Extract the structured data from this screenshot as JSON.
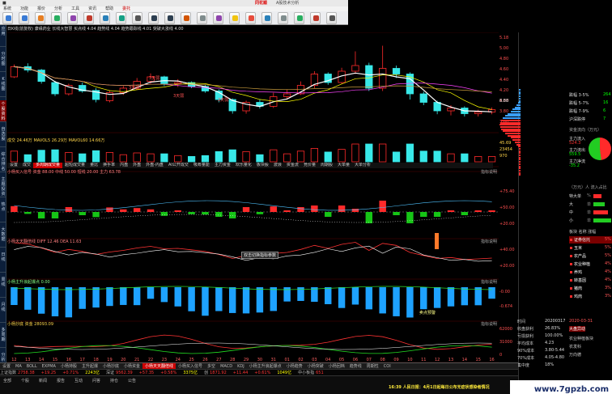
{
  "window": {
    "brand": "同花顺",
    "title": "A股技术分析",
    "menu": [
      "系统",
      "功能",
      "报价",
      "分析",
      "工具",
      "资讯",
      "帮助"
    ],
    "menu_accent": "委托",
    "toolbar_icons": [
      "back-icon",
      "forward-icon",
      "home-icon",
      "refresh-icon",
      "grid-icon",
      "chart-icon",
      "kline-icon",
      "list-icon",
      "search-icon",
      "zoom-in-icon",
      "zoom-out-icon",
      "news-icon",
      "f10-icon",
      "calc-icon",
      "star-icon",
      "alert-icon",
      "table-icon",
      "settings-icon",
      "draw-icon",
      "pen-icon",
      "print-icon"
    ]
  },
  "left_tabs": [
    "应用",
    "分时图",
    "K线图",
    "个股资料",
    "自选股",
    "综合排名",
    "主题投资",
    "热点",
    "大数据",
    "日线",
    "周线",
    "月线",
    "多周期",
    "分析"
  ],
  "main_chart": {
    "header": "日K线(前复权) 康缘药业 长线大智慧 买点线 4.04 趋势线 4.04 趋势跟踪线 4.01 突破大涨线 4.00",
    "price_labels": [
      "5.18",
      "5.00",
      "4.80",
      "4.60",
      "4.40",
      "4.20",
      "4.00",
      "3.80",
      "3.60"
    ],
    "annotations": [
      "3天弱",
      "3天弱",
      "2天弱",
      "3天弱"
    ],
    "right_label": "8.88"
  },
  "volume_panel": {
    "header": "成交 24.46万 MAVOL5 26.29万 MAVOL60 14.66万",
    "right_labels": [
      "45.69",
      "23454",
      "970"
    ],
    "tabs": [
      "设置",
      "成交",
      "多周期成交量",
      "超短成交量",
      "量比",
      "换手率",
      "内盘",
      "外盘",
      "外盘-内盘",
      "AI公开成交",
      "吸筹量能",
      "主力资金",
      "欢乐量化",
      "板块股",
      "波浪",
      "资金流",
      "竞价量",
      "周期股",
      "大单量",
      "大单分析"
    ]
  },
  "indicator1": {
    "header": "小杨买入信号 资金 88.00 中线 50.00 短线 20.00 主力 63.78",
    "right_label": "指标说明",
    "scale": [
      "+75.40",
      "+50.00",
      "+20.00"
    ]
  },
  "indicator2": {
    "header": "小杨天天翻倍线 DIFF 12.46 DEA 11.63",
    "right_label": "指标说明",
    "tooltip": "双击切换指标参数",
    "marker": "卖点预警",
    "scale": [
      "+40.00",
      "+20.00"
    ]
  },
  "indicator3": {
    "header": "小杨主升浪起爆点 0.00",
    "right_label": "指标说明",
    "scale": [
      "-0.00",
      "-0.674"
    ]
  },
  "indicator4": {
    "header": "小杨抄底 资金 28093.09",
    "right_label": "指标说明",
    "scale": [
      "62000",
      "31000",
      "0"
    ]
  },
  "x_axis": [
    "12",
    "13",
    "14",
    "15",
    "16",
    "17",
    "18",
    "19",
    "20",
    "21",
    "22",
    "23",
    "24",
    "25",
    "26",
    "27",
    "28",
    "29",
    "30",
    "31",
    "01",
    "02",
    "03",
    "04",
    "05",
    "06",
    "07",
    "08",
    "09",
    "10",
    "11",
    "12",
    "13",
    "14",
    "15",
    "16"
  ],
  "bottom_tabs": [
    "设置",
    "MA",
    "BOLL",
    "EXPMA",
    "小杨持股",
    "主升起爆",
    "小杨抄底",
    "小杨资金",
    "小杨天天翻倍线",
    "小杨买入信号",
    "多空",
    "MACD",
    "KDJ",
    "小杨主升浪起爆点",
    "小杨趋势",
    "小杨突破",
    "小杨回档",
    "趋势线",
    "周期性",
    "COI"
  ],
  "status_bar": [
    {
      "label": "上证指数",
      "value": "2758.38",
      "color": "#ff3333"
    },
    {
      "label": "",
      "value": "+19.25",
      "color": "#ff3333"
    },
    {
      "label": "",
      "value": "+0.71%",
      "color": "#ff3333"
    },
    {
      "label": "",
      "value": "2243亿",
      "color": "#ffff00"
    },
    {
      "label": "深证",
      "value": "9562.39",
      "color": "#ff3333"
    },
    {
      "label": "",
      "value": "+57.35",
      "color": "#ff3333"
    },
    {
      "label": "",
      "value": "+0.58%",
      "color": "#ff3333"
    },
    {
      "label": "",
      "value": "3375亿",
      "color": "#ffff00"
    },
    {
      "label": "创",
      "value": "1871.92",
      "color": "#ff3333"
    },
    {
      "label": "",
      "value": "+11.44",
      "color": "#ff3333"
    },
    {
      "label": "",
      "value": "+0.61%",
      "color": "#ff3333"
    },
    {
      "label": "",
      "value": "1049亿",
      "color": "#ffff00"
    },
    {
      "label": "中小板指",
      "value": "651",
      "color": "#ff3333"
    }
  ],
  "news_links": [
    "全部",
    "个股",
    "新闻",
    "报告",
    "互动",
    "问答",
    "持仓",
    "公告"
  ],
  "ticker": "16:39 人民日报：4月1日起每日公布无症状感染者情况",
  "right_panel": {
    "rise_fall": [
      {
        "label": "跌幅 3-5%",
        "value": "264",
        "color": "#00ff00"
      },
      {
        "label": "跌幅 5-7%",
        "value": "16",
        "color": "#00ff00"
      },
      {
        "label": "跌幅 7-9%",
        "value": "6",
        "color": "#00ff00"
      },
      {
        "label": "沪深跌停",
        "value": "7",
        "color": "#00ff00"
      }
    ],
    "fund_title": "资金流向（万元）",
    "funds": [
      {
        "label": "主力流入",
        "value": "524.3",
        "color": "#ff3333"
      },
      {
        "label": "主力流出",
        "value": "559.5",
        "color": "#00ff00"
      },
      {
        "label": "主力净流",
        "value": "-35.2",
        "color": "#00ff00"
      }
    ],
    "flow_title": "（万元）人 流入占比",
    "flow": [
      {
        "label": "特大单",
        "value": "%"
      },
      {
        "label": "大",
        "value": "单"
      },
      {
        "label": "中",
        "value": "单"
      },
      {
        "label": "小",
        "value": "单"
      }
    ],
    "sector_title": "板块 名称 涨幅",
    "sectors": [
      {
        "name": "证券信托",
        "value": "5%"
      },
      {
        "name": "玉米",
        "value": "5%"
      },
      {
        "name": "农产品",
        "value": "5%"
      },
      {
        "name": "农业种植",
        "value": "4%"
      },
      {
        "name": "养鸡",
        "value": "4%"
      },
      {
        "name": "转基因",
        "value": "4%"
      },
      {
        "name": "猪肉",
        "value": "3%"
      },
      {
        "name": "鸡肉",
        "value": "3%"
      }
    ],
    "info": [
      {
        "label": "时间",
        "value": "20200317"
      },
      {
        "label": "收盘获利",
        "value": "26.83%"
      },
      {
        "label": "亏损获利",
        "value": "100.00%"
      },
      {
        "label": "平均成本",
        "value": "4.23"
      },
      {
        "label": "90%成本",
        "value": "3.80-5.44"
      },
      {
        "label": "70%成本",
        "value": "4.05-4.80"
      },
      {
        "label": "集中度",
        "value": "18%"
      }
    ],
    "date_red": "2020-03-31",
    "news_title": "大盘异动",
    "sector_news": [
      "农业种植板块",
      "农发科",
      "万向德"
    ]
  },
  "watermark": "www.7gpzb.com",
  "chart_data": [
    {
      "type": "candlestick",
      "title": "日K线(前复权) 康缘药业",
      "ylim": [
        3.6,
        5.2
      ],
      "candles": [
        {
          "o": 4.5,
          "c": 4.68,
          "h": 4.72,
          "l": 4.48
        },
        {
          "o": 4.68,
          "c": 4.62,
          "h": 4.74,
          "l": 4.58
        },
        {
          "o": 4.62,
          "c": 4.42,
          "h": 4.64,
          "l": 4.38
        },
        {
          "o": 4.4,
          "c": 4.2,
          "h": 4.43,
          "l": 4.16
        },
        {
          "o": 4.2,
          "c": 4.35,
          "h": 4.38,
          "l": 4.17
        },
        {
          "o": 4.35,
          "c": 4.25,
          "h": 4.4,
          "l": 4.22
        },
        {
          "o": 4.26,
          "c": 4.1,
          "h": 4.3,
          "l": 4.05
        },
        {
          "o": 4.08,
          "c": 4.22,
          "h": 4.26,
          "l": 4.05
        },
        {
          "o": 4.22,
          "c": 4.3,
          "h": 4.34,
          "l": 4.18
        },
        {
          "o": 4.3,
          "c": 4.42,
          "h": 4.48,
          "l": 4.28
        },
        {
          "o": 4.42,
          "c": 4.5,
          "h": 4.56,
          "l": 4.38
        },
        {
          "o": 4.5,
          "c": 4.38,
          "h": 4.52,
          "l": 4.34
        },
        {
          "o": 4.38,
          "c": 4.4,
          "h": 4.46,
          "l": 4.32
        },
        {
          "o": 4.4,
          "c": 4.33,
          "h": 4.42,
          "l": 4.3
        },
        {
          "o": 4.33,
          "c": 4.25,
          "h": 4.36,
          "l": 4.22
        },
        {
          "o": 4.25,
          "c": 4.1,
          "h": 4.28,
          "l": 4.05
        },
        {
          "o": 4.1,
          "c": 3.9,
          "h": 4.12,
          "l": 3.85
        },
        {
          "o": 3.9,
          "c": 4.05,
          "h": 4.08,
          "l": 3.85
        },
        {
          "o": 4.05,
          "c": 3.98,
          "h": 4.1,
          "l": 3.94
        },
        {
          "o": 3.98,
          "c": 4.15,
          "h": 4.22,
          "l": 3.95
        },
        {
          "o": 4.15,
          "c": 4.2,
          "h": 4.28,
          "l": 4.1
        },
        {
          "o": 4.2,
          "c": 4.35,
          "h": 4.42,
          "l": 4.18
        },
        {
          "o": 4.35,
          "c": 4.55,
          "h": 4.6,
          "l": 4.3
        },
        {
          "o": 4.55,
          "c": 4.4,
          "h": 4.58,
          "l": 4.36
        },
        {
          "o": 4.4,
          "c": 4.6,
          "h": 4.66,
          "l": 4.38
        },
        {
          "o": 4.6,
          "c": 4.7,
          "h": 4.95,
          "l": 4.55
        },
        {
          "o": 4.7,
          "c": 4.3,
          "h": 4.75,
          "l": 4.25
        },
        {
          "o": 4.3,
          "c": 4.65,
          "h": 5.05,
          "l": 4.25
        },
        {
          "o": 4.65,
          "c": 4.55,
          "h": 4.7,
          "l": 4.48
        },
        {
          "o": 4.55,
          "c": 4.2,
          "h": 4.58,
          "l": 4.1
        },
        {
          "o": 4.2,
          "c": 4.05,
          "h": 4.24,
          "l": 4.0
        },
        {
          "o": 4.05,
          "c": 3.9,
          "h": 4.08,
          "l": 3.84
        },
        {
          "o": 3.9,
          "c": 3.95,
          "h": 4.0,
          "l": 3.82
        },
        {
          "o": 3.95,
          "c": 3.85,
          "h": 3.98,
          "l": 3.8
        },
        {
          "o": 3.85,
          "c": 3.88,
          "h": 3.92,
          "l": 3.8
        },
        {
          "o": 3.88,
          "c": 3.92,
          "h": 3.96,
          "l": 3.84
        }
      ]
    }
  ]
}
